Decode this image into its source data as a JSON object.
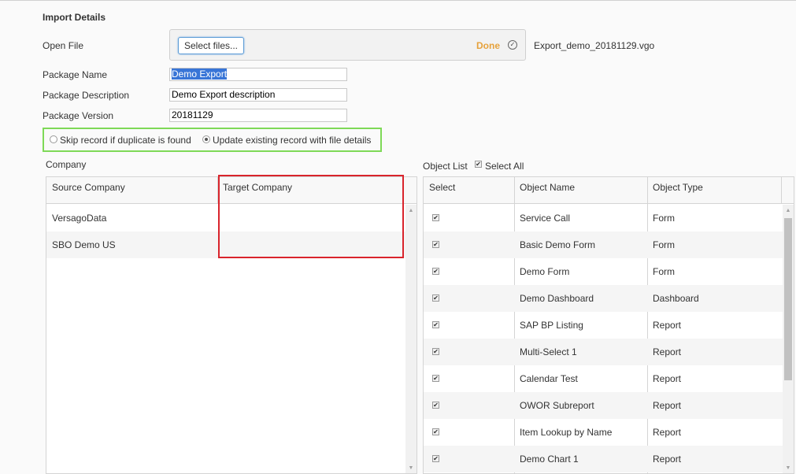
{
  "section_title": "Import Details",
  "open_file": {
    "label": "Open File",
    "button_label": "Select files...",
    "status": "Done",
    "status_icon": "check-circle-icon",
    "filename": "Export_demo_20181129.vgo"
  },
  "package": {
    "name_label": "Package Name",
    "name_value": "Demo Export",
    "description_label": "Package Description",
    "description_value": "Demo Export description",
    "version_label": "Package Version",
    "version_value": "20181129"
  },
  "duplicate_options": {
    "skip_label": "Skip record if duplicate is found",
    "update_label": "Update existing record with file details",
    "selected": "update"
  },
  "company": {
    "label": "Company",
    "columns": [
      "Source Company",
      "Target Company"
    ],
    "rows": [
      {
        "source": "VersagoData",
        "target": ""
      },
      {
        "source": "SBO Demo US",
        "target": ""
      }
    ]
  },
  "object_list": {
    "label": "Object List",
    "select_all_label": "Select All",
    "select_all_checked": true,
    "columns": [
      "Select",
      "Object Name",
      "Object Type"
    ],
    "rows": [
      {
        "selected": true,
        "name": "Service Call",
        "type": "Form"
      },
      {
        "selected": true,
        "name": "Basic Demo Form",
        "type": "Form"
      },
      {
        "selected": true,
        "name": "Demo Form",
        "type": "Form"
      },
      {
        "selected": true,
        "name": "Demo Dashboard",
        "type": "Dashboard"
      },
      {
        "selected": true,
        "name": "SAP BP Listing",
        "type": "Report"
      },
      {
        "selected": true,
        "name": "Multi-Select 1",
        "type": "Report"
      },
      {
        "selected": true,
        "name": "Calendar Test",
        "type": "Report"
      },
      {
        "selected": true,
        "name": "OWOR Subreport",
        "type": "Report"
      },
      {
        "selected": true,
        "name": "Item Lookup by Name",
        "type": "Report"
      },
      {
        "selected": true,
        "name": "Demo Chart 1",
        "type": "Report"
      }
    ]
  },
  "colors": {
    "done": "#e6a23c",
    "highlight_green": "#7ed957",
    "highlight_red": "#d9242c",
    "text_selection": "#3875d7"
  }
}
